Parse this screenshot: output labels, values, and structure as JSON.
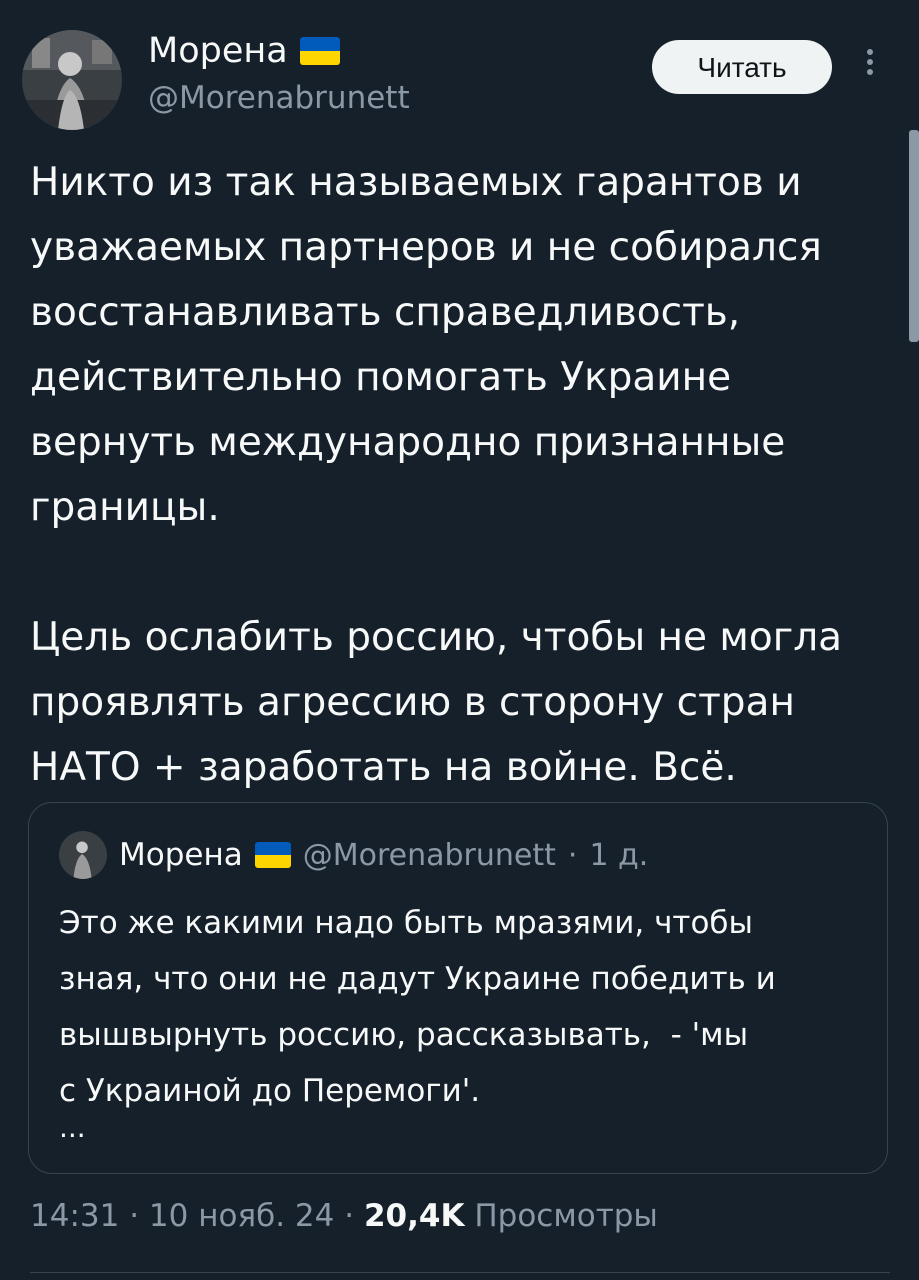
{
  "author": {
    "name": "Морена",
    "handle": "@Morenabrunett",
    "flag_colors": [
      "#005bbb",
      "#ffd500"
    ]
  },
  "header": {
    "follow_label": "Читать",
    "more_icon": "more-vertical-icon"
  },
  "tweet": {
    "text": "Никто из так называемых гарантов и\nуважаемых партнеров и не собирался\nвосстанавливать справедливость,\nдействительно помогать Украине\nвернуть международно признанные\nграницы.\n\nЦель ослабить россию, чтобы не могла\nпроявлять агрессию в сторону стран\nНАТО + заработать на войне. Всё."
  },
  "quote": {
    "name": "Морена",
    "handle": "@Morenabrunett",
    "separator": "·",
    "time": "1 д.",
    "text": "Это же какими надо быть мразями, чтобы\nзная, что они не дадут Украине победить и\nвышвырнуть россию, рассказывать,  - 'мы\nс Украиной до Перемоги'.",
    "ellipsis": "..."
  },
  "footer": {
    "time": "14:31",
    "date": "10 нояб. 24",
    "separator": "·",
    "views_count": "20,4K",
    "views_label": "Просмотры"
  },
  "colors": {
    "background": "#15202b",
    "text": "#f7f9f9",
    "secondary": "#8b98a5",
    "border": "#38444d"
  }
}
